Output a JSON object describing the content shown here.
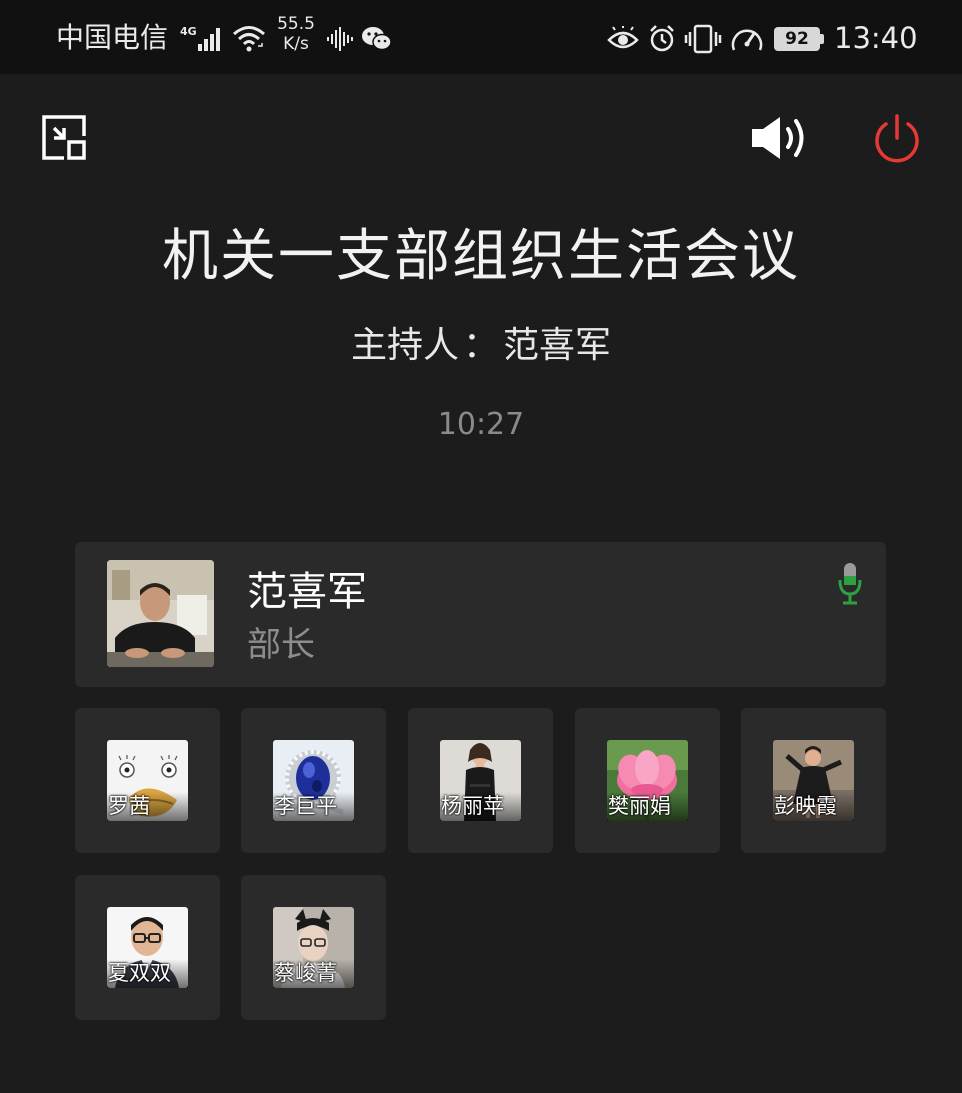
{
  "status_bar": {
    "carrier": "中国电信",
    "network_type": "4G",
    "net_speed_value": "55.5",
    "net_speed_unit": "K/s",
    "battery": "92",
    "time": "13:40",
    "icons": [
      "signal-icon",
      "wifi-icon",
      "audio-wave-icon",
      "wechat-icon",
      "eye-icon",
      "alarm-icon",
      "vibrate-icon",
      "speedometer-icon",
      "battery-icon"
    ]
  },
  "controls": {
    "minimize_icon": "minimize-window-icon",
    "speaker_icon": "speaker-icon",
    "power_icon": "power-icon",
    "power_color": "#e53935"
  },
  "meeting": {
    "title": "机关一支部组织生活会议",
    "host_label": "主持人",
    "host_separator": "：",
    "host_name": "范喜军",
    "elapsed": "10:27"
  },
  "host_card": {
    "name": "范喜军",
    "role": "部长",
    "mic_icon": "microphone-icon",
    "mic_color": "#2ea043"
  },
  "participants": [
    {
      "name": "罗茜",
      "avatar": "cartoon-duck"
    },
    {
      "name": "李巨平",
      "avatar": "sapphire-ring"
    },
    {
      "name": "杨丽苹",
      "avatar": "woman-portrait"
    },
    {
      "name": "樊丽娟",
      "avatar": "pink-lotus"
    },
    {
      "name": "彭映霞",
      "avatar": "child-dancing"
    },
    {
      "name": "夏双双",
      "avatar": "man-glasses"
    },
    {
      "name": "蔡峻菁",
      "avatar": "cat-ears-selfie"
    }
  ],
  "colors": {
    "background": "#1c1c1c",
    "status_bar": "#111111",
    "card": "#2a2a2a"
  }
}
